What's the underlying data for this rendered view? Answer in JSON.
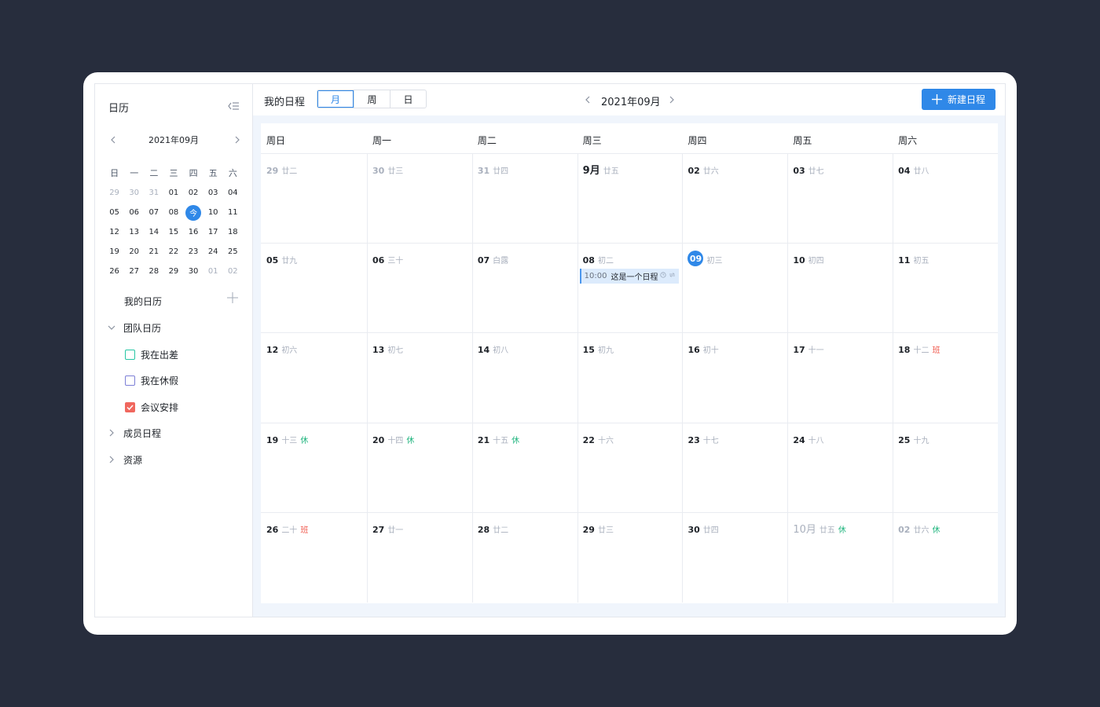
{
  "sidebar": {
    "title": "日历",
    "mini": {
      "title": "2021年09月",
      "weekdays": [
        "日",
        "一",
        "二",
        "三",
        "四",
        "五",
        "六"
      ],
      "rows": [
        [
          "29",
          "30",
          "31",
          "01",
          "02",
          "03",
          "04"
        ],
        [
          "05",
          "06",
          "07",
          "08",
          "今",
          "10",
          "11"
        ],
        [
          "12",
          "13",
          "14",
          "15",
          "16",
          "17",
          "18"
        ],
        [
          "19",
          "20",
          "21",
          "22",
          "23",
          "24",
          "25"
        ],
        [
          "26",
          "27",
          "28",
          "29",
          "30",
          "01",
          "02"
        ]
      ]
    },
    "my_calendar": "我的日历",
    "team_calendar": "团队日历",
    "team_items": [
      {
        "label": "我在出差",
        "color": "#26c6a4",
        "checked": false
      },
      {
        "label": "我在休假",
        "color": "#7c7fd6",
        "checked": false
      },
      {
        "label": "会议安排",
        "color": "#f0675e",
        "checked": true
      }
    ],
    "member_schedule": "成员日程",
    "resources": "资源"
  },
  "toolbar": {
    "title": "我的日程",
    "views": [
      "月",
      "周",
      "日"
    ],
    "active_view": "月",
    "period": "2021年09月",
    "new_button": "新建日程"
  },
  "calendar": {
    "weekdays": [
      "周日",
      "周一",
      "周二",
      "周三",
      "周四",
      "周五",
      "周六"
    ],
    "weeks": [
      [
        {
          "d": "29",
          "l": "廿二",
          "muted": true
        },
        {
          "d": "30",
          "l": "廿三",
          "muted": true
        },
        {
          "d": "31",
          "l": "廿四",
          "muted": true
        },
        {
          "d": "9月",
          "l": "廿五",
          "big": true
        },
        {
          "d": "02",
          "l": "廿六"
        },
        {
          "d": "03",
          "l": "廿七"
        },
        {
          "d": "04",
          "l": "廿八"
        }
      ],
      [
        {
          "d": "05",
          "l": "廿九"
        },
        {
          "d": "06",
          "l": "三十"
        },
        {
          "d": "07",
          "l": "白露"
        },
        {
          "d": "08",
          "l": "初二",
          "event": {
            "time": "10:00",
            "title": "这是一个日程"
          }
        },
        {
          "d": "09",
          "l": "初三",
          "today": true
        },
        {
          "d": "10",
          "l": "初四"
        },
        {
          "d": "11",
          "l": "初五"
        }
      ],
      [
        {
          "d": "12",
          "l": "初六"
        },
        {
          "d": "13",
          "l": "初七"
        },
        {
          "d": "14",
          "l": "初八"
        },
        {
          "d": "15",
          "l": "初九"
        },
        {
          "d": "16",
          "l": "初十"
        },
        {
          "d": "17",
          "l": "十一"
        },
        {
          "d": "18",
          "l": "十二",
          "tag": "班",
          "tagType": "work"
        }
      ],
      [
        {
          "d": "19",
          "l": "十三",
          "tag": "休",
          "tagType": "rest"
        },
        {
          "d": "20",
          "l": "十四",
          "tag": "休",
          "tagType": "rest"
        },
        {
          "d": "21",
          "l": "十五",
          "tag": "休",
          "tagType": "rest"
        },
        {
          "d": "22",
          "l": "十六"
        },
        {
          "d": "23",
          "l": "十七"
        },
        {
          "d": "24",
          "l": "十八"
        },
        {
          "d": "25",
          "l": "十九"
        }
      ],
      [
        {
          "d": "26",
          "l": "二十",
          "tag": "班",
          "tagType": "work"
        },
        {
          "d": "27",
          "l": "廿一"
        },
        {
          "d": "28",
          "l": "廿二"
        },
        {
          "d": "29",
          "l": "廿三"
        },
        {
          "d": "30",
          "l": "廿四"
        },
        {
          "d": "10月",
          "l": "廿五",
          "tag": "休",
          "tagType": "rest",
          "muted": true,
          "big": true
        },
        {
          "d": "02",
          "l": "廿六",
          "tag": "休",
          "tagType": "rest",
          "muted": true
        }
      ]
    ]
  },
  "colors": {
    "accent": "#2f88e8",
    "background": "#272d3d",
    "rest": "#21b57f",
    "work": "#f0584c"
  }
}
